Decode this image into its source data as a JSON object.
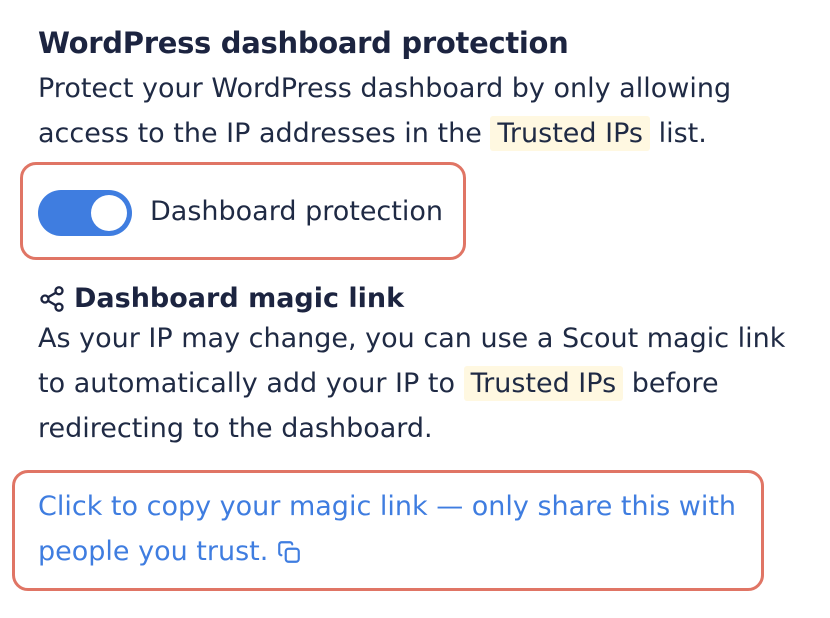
{
  "section": {
    "title": "WordPress dashboard protection",
    "desc_line1": "Protect your WordPress dashboard by only allowing",
    "desc_line2_prefix": "access to the IP addresses in the",
    "desc_line2_pill": "Trusted IPs",
    "desc_line2_suffix": "list."
  },
  "toggle": {
    "label": "Dashboard protection",
    "state": "on",
    "color": "#3f7de0"
  },
  "magic": {
    "icon": "share-icon",
    "title": "Dashboard magic link",
    "desc_line1": "As your IP may change, you can use a Scout magic link",
    "desc_line2_prefix": "to automatically add your IP to",
    "desc_line2_pill": "Trusted IPs",
    "desc_line2_suffix": "before",
    "desc_line3": "redirecting to the dashboard.",
    "link_line1": "Click to copy your magic link — only share this with",
    "link_line2": "people you trust.",
    "copy_icon": "copy-icon"
  },
  "colors": {
    "accent": "#3f7de0",
    "highlight_outline": "#e07565",
    "pill_background": "#fff8e1"
  }
}
